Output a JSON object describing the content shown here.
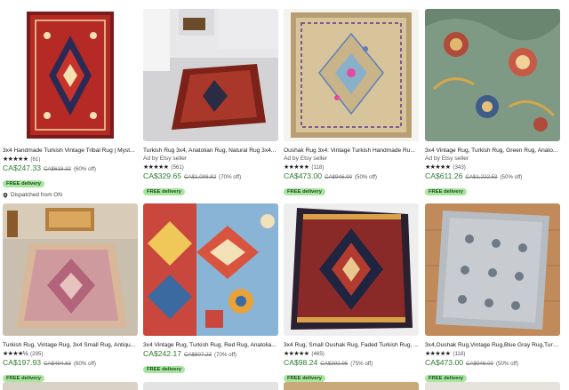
{
  "listings": [
    {
      "title": "3x4 Handmade Turkish Vintage Tribal Rug | Myst...",
      "seller": "",
      "stars": "★★★★★",
      "review_count": "(61)",
      "price": "CA$247.33",
      "original_price": "CA$618.32",
      "discount": "(60% off)",
      "badge": "FREE delivery",
      "dispatch": "Dispatched from ON",
      "image_icon": "red-medallion-rug-image"
    },
    {
      "title": "Turkish Rug 3x4, Anatolian Rug, Natural Rug 3x4...",
      "seller": "Ad by Etsy seller",
      "stars": "★★★★★",
      "review_count": "(561)",
      "price": "CA$329.65",
      "original_price": "CA$1,098.82",
      "discount": "(70% off)",
      "badge": "FREE delivery",
      "image_icon": "rug-in-room-image"
    },
    {
      "title": "Oushak Rug 3x4: Vintage Turkish Handmade Ru...",
      "seller": "Ad by Etsy seller",
      "stars": "★★★★★",
      "review_count": "(118)",
      "price": "CA$473.00",
      "original_price": "CA$946.00",
      "discount": "(50% off)",
      "badge": "FREE delivery",
      "image_icon": "beige-oushak-rug-image"
    },
    {
      "title": "3x4 Vintage Rug, Turkish Rug, Green Rug, Anato...",
      "seller": "Ad by Etsy seller",
      "stars": "★★★★★",
      "review_count": "(343)",
      "price": "CA$611.26",
      "original_price": "CA$1,222.53",
      "discount": "(50% off)",
      "badge": "FREE delivery",
      "image_icon": "green-floral-rug-image"
    },
    {
      "title": "Turkish Rug, Vintage Rug, 3x4 Small Rug, Antiqu...",
      "seller": "",
      "stars": "★★★★½",
      "review_count": "(295)",
      "price": "CA$197.93",
      "original_price": "CA$494.83",
      "discount": "(60% off)",
      "badge": "FREE delivery",
      "image_icon": "pink-rug-on-floor-image"
    },
    {
      "title": "3x4 Vintage Rug, Turkish Rug, Red Rug, Anatolia...",
      "seller": "",
      "stars": "",
      "review_count": "",
      "price": "CA$242.17",
      "original_price": "CA$807.23",
      "discount": "(70% off)",
      "badge": "FREE delivery",
      "image_icon": "red-blue-kilim-image"
    },
    {
      "title": "3x4 Rug, Small Oushak Rug, Faded Turkish Rug, ...",
      "seller": "",
      "stars": "★★★★★",
      "review_count": "(465)",
      "price": "CA$98.24",
      "original_price": "CA$392.96",
      "discount": "(75% off)",
      "badge": "FREE delivery",
      "image_icon": "dark-red-rug-image"
    },
    {
      "title": "3x4,Oushak Rug,Vintage Rug,Blue Gray Rug,Turk...",
      "seller": "",
      "stars": "★★★★★",
      "review_count": "(118)",
      "price": "CA$473.00",
      "original_price": "CA$946.00",
      "discount": "(50% off)",
      "badge": "FREE delivery",
      "image_icon": "blue-gray-rug-on-wood-image"
    }
  ],
  "colors": {
    "price_green": "#2c7a30",
    "badge_bg": "#a8e6a0",
    "badge_text": "#1c4a1a"
  }
}
